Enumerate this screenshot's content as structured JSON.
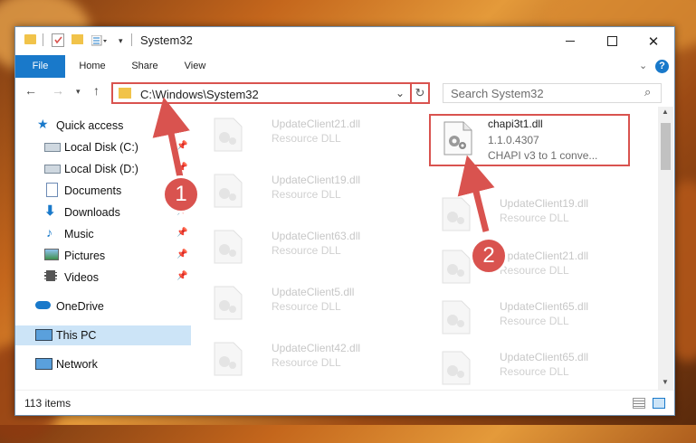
{
  "window": {
    "title": "System32",
    "controls": [
      "minimize",
      "maximize",
      "close"
    ]
  },
  "ribbon": {
    "tabs": [
      "File",
      "Home",
      "Share",
      "View"
    ]
  },
  "address": {
    "path": "C:\\Windows\\System32",
    "search_placeholder": "Search System32"
  },
  "sidebar": {
    "items": [
      {
        "label": "Quick access",
        "icon": "star-icon",
        "pinned": false
      },
      {
        "label": "Local Disk (C:)",
        "icon": "drive-icon",
        "pinned": true
      },
      {
        "label": "Local Disk (D:)",
        "icon": "drive-icon",
        "pinned": true
      },
      {
        "label": "Documents",
        "icon": "document-icon",
        "pinned": true
      },
      {
        "label": "Downloads",
        "icon": "download-icon",
        "pinned": true
      },
      {
        "label": "Music",
        "icon": "music-icon",
        "pinned": true
      },
      {
        "label": "Pictures",
        "icon": "pictures-icon",
        "pinned": true
      },
      {
        "label": "Videos",
        "icon": "video-icon",
        "pinned": true
      },
      {
        "label": "OneDrive",
        "icon": "cloud-icon",
        "pinned": false
      },
      {
        "label": "This PC",
        "icon": "computer-icon",
        "pinned": false,
        "selected": true
      },
      {
        "label": "Network",
        "icon": "network-icon",
        "pinned": false
      }
    ]
  },
  "files": [
    {
      "name": "UpdateClient21.dll",
      "desc": "Resource DLL"
    },
    {
      "name": "chapi3t1.dll",
      "version": "1.1.0.4307",
      "desc": "CHAPI v3 to 1 conve...",
      "highlighted": true
    },
    {
      "name": "UpdateClient19.dll",
      "desc": "Resource DLL"
    },
    {
      "name": "UpdateClient19.dll",
      "desc": "Resource DLL"
    },
    {
      "name": "UpdateClient63.dll",
      "desc": "Resource DLL"
    },
    {
      "name": "UpdateClient21.dll",
      "desc": "Resource DLL"
    },
    {
      "name": "UpdateClient5.dll",
      "desc": "Resource DLL"
    },
    {
      "name": "UpdateClient65.dll",
      "desc": "Resource DLL"
    },
    {
      "name": "UpdateClient42.dll",
      "desc": "Resource DLL"
    },
    {
      "name": "UpdateClient65.dll",
      "desc": "Resource DLL"
    }
  ],
  "status": {
    "item_count": "113 items"
  },
  "annotations": {
    "step1": "1",
    "step2": "2",
    "accent_color": "#d9534f"
  },
  "colors": {
    "file_tab": "#1979ca",
    "selection": "#cce4f7"
  }
}
